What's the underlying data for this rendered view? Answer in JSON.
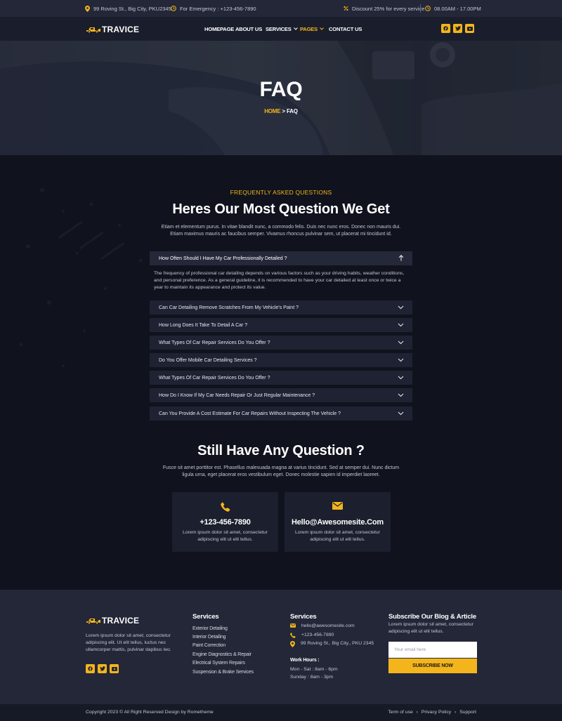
{
  "topbar": {
    "address": "99 Roving St., Big City, PKU2345",
    "emergency": "For Emergency : +123-456-7890",
    "discount": "Discount 25% for every service",
    "hours": "08.00AM - 17.00PM"
  },
  "brand": {
    "name": "TRAVICE"
  },
  "nav": {
    "items": [
      "HOMEPAGE",
      "ABOUT US",
      "SERVICES",
      "PAGES",
      "CONTACT US"
    ],
    "active": "PAGES"
  },
  "hero": {
    "title": "FAQ",
    "crumb_home": "HOME",
    "crumb_sep": ">",
    "crumb_current": "FAQ"
  },
  "faq": {
    "eyebrow": "FREQUENTLY ASKED QUESTIONS",
    "title": "Heres Our Most Question We Get",
    "lead": "Etiam et elementum purus. In vitae blandit nunc, a commodo felis. Duis nec nunc eros. Donec non mauris dui. Etiam maximus mauris ac faucibus semper. Vivamus rhoncus pulvinar sem, ut placerat mi tincidunt id.",
    "items": [
      {
        "q": "How Often Should I Have My Car Professionally Detailed ?",
        "a": "The frequency of professional car detailing depends on various factors such as your driving habits, weather conditions, and personal preference. As a general guideline, it is recommended to have your car detailed at least once or twice a year to maintain its appearance and protect its value."
      },
      {
        "q": "Can Car Detailing Remove Scratches From My Vehicle's Paint ?"
      },
      {
        "q": "How Long Does It Take To Detail A Car ?"
      },
      {
        "q": "What Types Of Car Repair Services Do You Offer ?"
      },
      {
        "q": "Do You Offer Mobile Car Detailing Services ?"
      },
      {
        "q": "What Types Of Car Repair Services Do You Offer ?"
      },
      {
        "q": "How Do I Know If My Car Needs Repair Or Just Regular Maintenance ?"
      },
      {
        "q": "Can You Provide A Cost Estimate For Car Repairs Without Inspecting The Vehicle ?"
      }
    ]
  },
  "still": {
    "title": "Still Have Any Question ?",
    "lead": "Fusce sit amet porttitor est. Phasellus malesuada magna at varius tincidunt. Sed at semper dui. Nunc dictum ligula urna, eget placerat eros vestibulum eget. Donec molestie sapien id imperdiet laoreet.",
    "cards": [
      {
        "icon": "phone-icon",
        "title": "+123-456-7890",
        "desc": "Lorem ipsum dolor sit amet, consectetur adipiscing elit ut elit tellus."
      },
      {
        "icon": "envelope-icon",
        "title": "Hello@Awesomesite.Com",
        "desc": "Lorem ipsum dolor sit amet, consectetur adipiscing elit ut elit tellus."
      }
    ]
  },
  "footer": {
    "about": "Lorem ipsum dolor sit amet, consectetur adipiscing elit. Ut elit tellus, luctus nec ullamcorper mattis, pulvinar dapibus leo.",
    "services_title": "Services",
    "services": [
      "Exterior Detailing",
      "Interior Detailing",
      "Paint Correction",
      "Engine Diagnostics & Repair",
      "Electrical System Repairs",
      "Suspension & Brake Services"
    ],
    "contact_title": "Services",
    "email": "hello@awesomesite.com",
    "phone": "+123-456-7890",
    "address": "99 Roving St., Big City., PKU 2345",
    "hours_title": "Work Hours :",
    "hours_weekday": "Mon - Sat : 8am - 6pm",
    "hours_sunday": "Sunday : 8am - 3pm",
    "subscribe_title": "Subscribe Our Blog & Article",
    "subscribe_text": "Lorem ipsum dolor sit amet, consectetur adipiscing elit ut elit tellus.",
    "email_placeholder": "Your email here",
    "subscribe_button": "SUBSCRIBE NOW"
  },
  "bottom": {
    "copyright": "Copyright 2023 © All Right Reserved Design by Rometheme",
    "links": [
      "Term of use",
      "Privacy Policy",
      "Support"
    ]
  },
  "colors": {
    "accent": "#f3b51b",
    "background": "#10131d",
    "panel": "#1e2233",
    "topbar": "#232738"
  }
}
